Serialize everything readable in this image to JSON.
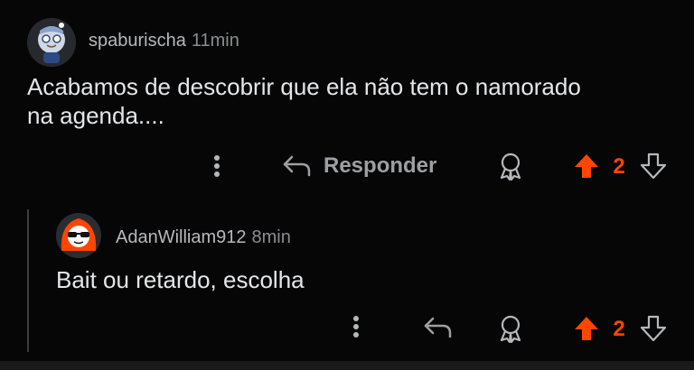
{
  "comments": [
    {
      "username": "spaburischa",
      "time": "11min",
      "text_line1": "Acabamos de descobrir que ela não tem o namorado",
      "text_line2": "na agenda....",
      "reply_label": "Responder",
      "votes": "2",
      "avatar_icon": "snoo-avatar-icon"
    },
    {
      "username": "AdanWilliam912",
      "time": "8min",
      "text": "Bait ou retardo, escolha",
      "votes": "2",
      "avatar_icon": "snoo-sunglasses-avatar-icon"
    }
  ],
  "colors": {
    "upvote": "#ff4500",
    "background": "#060606",
    "text": "#e4e6e8"
  }
}
